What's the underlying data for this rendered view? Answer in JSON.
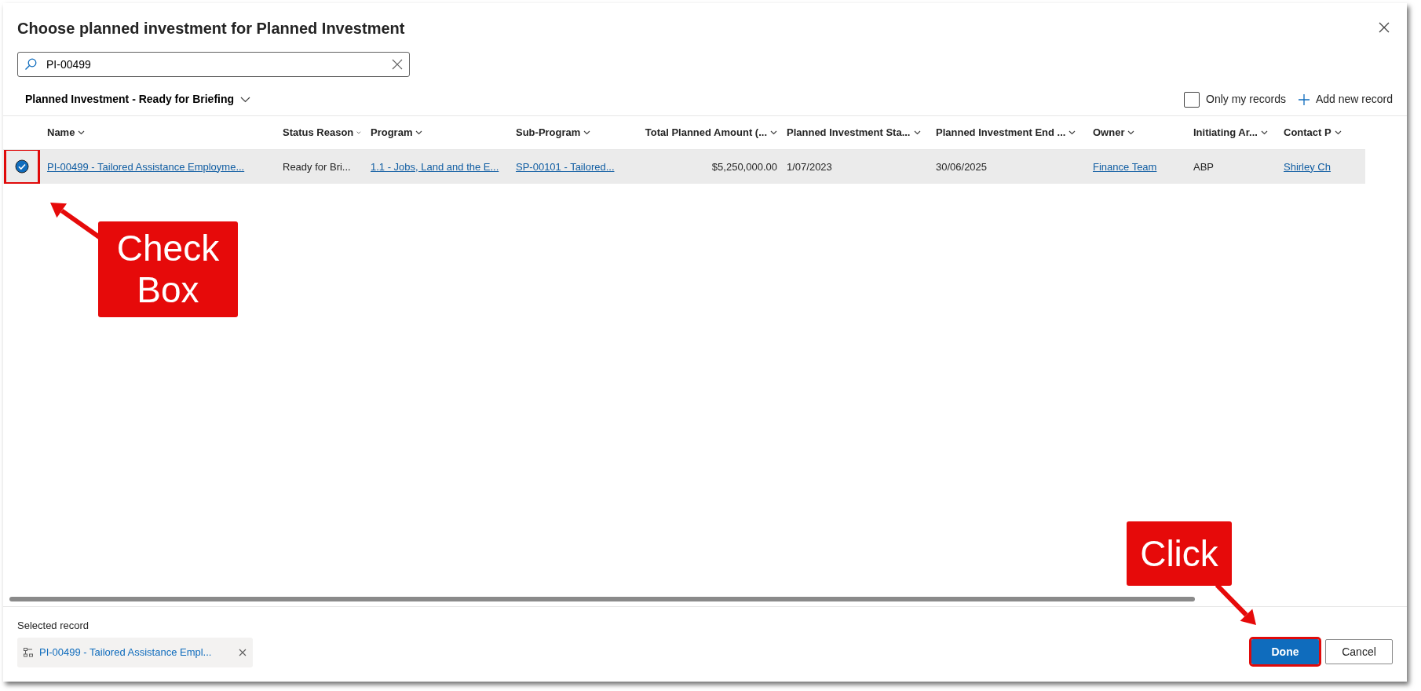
{
  "dialog": {
    "title": "Choose planned investment for Planned Investment"
  },
  "search": {
    "value": "PI-00499"
  },
  "view_selector": {
    "label": "Planned Investment - Ready for Briefing"
  },
  "only_my_records": {
    "label": "Only my records",
    "checked": false
  },
  "add_new_record": {
    "label": "Add new record"
  },
  "table": {
    "columns": [
      {
        "label": "Name"
      },
      {
        "label": "Status Reason"
      },
      {
        "label": "Program"
      },
      {
        "label": "Sub-Program"
      },
      {
        "label": "Total Planned Amount (..."
      },
      {
        "label": "Planned Investment Sta..."
      },
      {
        "label": "Planned Investment End ..."
      },
      {
        "label": "Owner"
      },
      {
        "label": "Initiating Ar..."
      },
      {
        "label": "Contact P"
      }
    ],
    "rows": [
      {
        "selected": true,
        "highlighted": true,
        "cells": [
          {
            "kind": "link",
            "text": "PI-00499 - Tailored Assistance Employme..."
          },
          {
            "kind": "text",
            "text": "Ready for Bri..."
          },
          {
            "kind": "link",
            "text": "1.1 - Jobs, Land and the E..."
          },
          {
            "kind": "link",
            "text": "SP-00101 - Tailored..."
          },
          {
            "kind": "amount",
            "text": "$5,250,000.00"
          },
          {
            "kind": "text",
            "text": "1/07/2023"
          },
          {
            "kind": "text",
            "text": "30/06/2025"
          },
          {
            "kind": "link",
            "text": "Finance Team"
          },
          {
            "kind": "text",
            "text": "ABP"
          },
          {
            "kind": "link",
            "text": "Shirley Ch"
          }
        ]
      }
    ]
  },
  "selected_record": {
    "label": "Selected record",
    "chip": "PI-00499 - Tailored Assistance Empl..."
  },
  "buttons": [
    {
      "label": "Done",
      "kind": "primary",
      "highlighted": true
    },
    {
      "label": "Cancel",
      "kind": "secondary",
      "highlighted": false
    }
  ],
  "annotations": [
    {
      "kind": "callout",
      "text": "Check Box"
    },
    {
      "kind": "callout",
      "text": "Click"
    }
  ]
}
